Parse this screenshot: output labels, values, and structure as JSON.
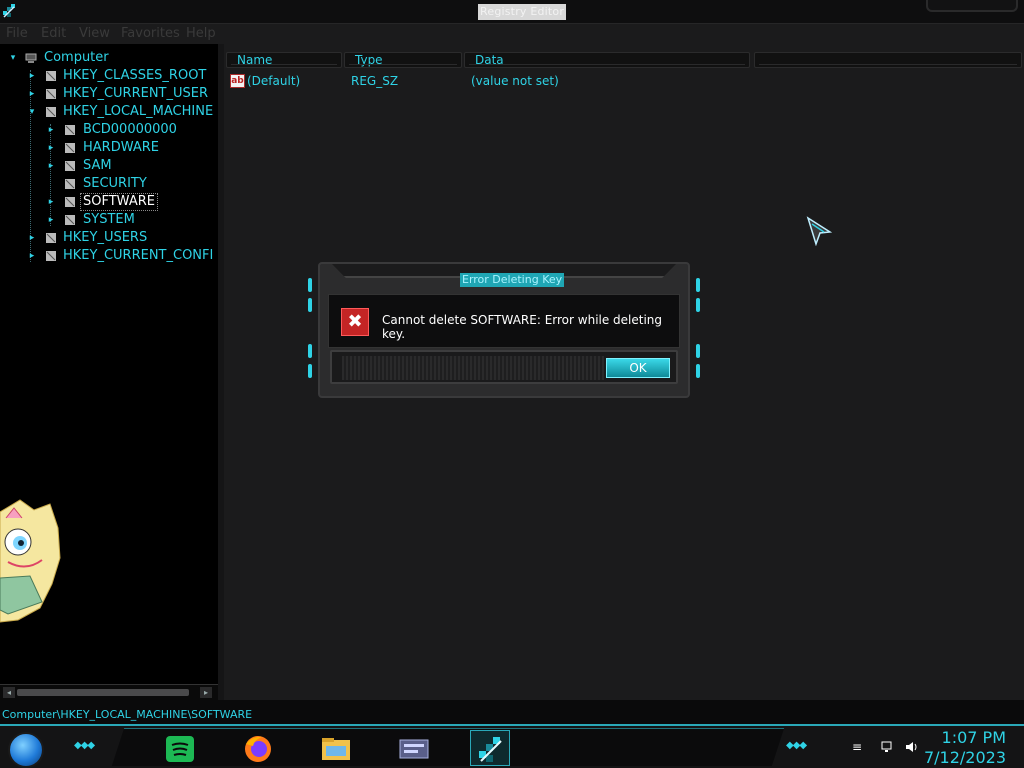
{
  "window": {
    "title": "Registry Editor",
    "icon": "regedit-icon"
  },
  "menu": {
    "items": [
      "File",
      "Edit",
      "View",
      "Favorites",
      "Help"
    ]
  },
  "tree": {
    "root": "Computer",
    "items": [
      {
        "label": "HKEY_CLASSES_ROOT",
        "expanded": false
      },
      {
        "label": "HKEY_CURRENT_USER",
        "expanded": false
      },
      {
        "label": "HKEY_LOCAL_MACHINE",
        "expanded": true
      },
      {
        "label": "BCD00000000",
        "expanded": false
      },
      {
        "label": "HARDWARE",
        "expanded": false
      },
      {
        "label": "SAM",
        "expanded": false
      },
      {
        "label": "SECURITY",
        "expanded": false
      },
      {
        "label": "SOFTWARE",
        "expanded": false,
        "selected": true
      },
      {
        "label": "SYSTEM",
        "expanded": false
      },
      {
        "label": "HKEY_USERS",
        "expanded": false
      },
      {
        "label": "HKEY_CURRENT_CONFI",
        "expanded": false
      }
    ]
  },
  "list": {
    "columns": [
      "Name",
      "Type",
      "Data"
    ],
    "rows": [
      {
        "name": "(Default)",
        "type": "REG_SZ",
        "data": "(value not set)"
      }
    ]
  },
  "status": {
    "path": "Computer\\HKEY_LOCAL_MACHINE\\SOFTWARE"
  },
  "dialog": {
    "title": "Error Deleting Key",
    "message": "Cannot delete SOFTWARE:  Error while deleting key.",
    "ok_label": "OK",
    "icon": "error-icon"
  },
  "taskbar": {
    "apps": [
      "spotify-icon",
      "firefox-icon",
      "file-explorer-icon",
      "control-panel-icon",
      "regedit-icon"
    ],
    "tray": [
      "network-icon",
      "volume-icon"
    ],
    "time": "1:07 PM",
    "date": "7/12/2023"
  },
  "colors": {
    "accent": "#2fd3e6",
    "background": "#1b1b1c",
    "tree_background": "#000000",
    "error": "#c42525"
  }
}
